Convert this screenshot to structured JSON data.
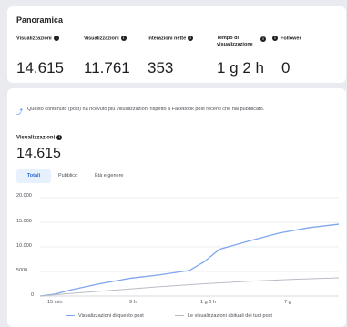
{
  "panorama": {
    "title": "Panoramica",
    "metrics": [
      {
        "label": "Visualizzazioni",
        "value": "14.615"
      },
      {
        "label": "Visualizzazioni",
        "value": "11.761"
      },
      {
        "label": "Interazioni nette",
        "value": "353"
      },
      {
        "label": "Tempo di visualizzazione",
        "value": "1 g 2 h"
      },
      {
        "label": "Follower",
        "value": "0"
      }
    ]
  },
  "notice": {
    "text": "Questo contenuto (post) ha ricevuto più visualizzazioni rispetto a Facebook post recenti che hai pubblicato."
  },
  "views": {
    "label": "Visualizzazioni",
    "value": "14.615"
  },
  "tabs": [
    "Totali",
    "Pubblico",
    "Età e genere"
  ],
  "chart_data": {
    "type": "line",
    "y_ticks": [
      "20.000",
      "15.000",
      "10.000",
      "5000",
      "0"
    ],
    "x_ticks": [
      "15 min",
      "9 h",
      "1 g 6 h",
      "7 g"
    ],
    "ylim": [
      0,
      20000
    ],
    "series": [
      {
        "name": "Visualizzazioni di questo post",
        "color": "#7fa6ee",
        "points": [
          [
            0,
            0
          ],
          [
            0.05,
            400
          ],
          [
            0.1,
            1200
          ],
          [
            0.2,
            2500
          ],
          [
            0.3,
            3600
          ],
          [
            0.4,
            4300
          ],
          [
            0.5,
            5200
          ],
          [
            0.55,
            7000
          ],
          [
            0.6,
            9500
          ],
          [
            0.7,
            11200
          ],
          [
            0.8,
            12800
          ],
          [
            0.9,
            13900
          ],
          [
            1.0,
            14615
          ]
        ]
      },
      {
        "name": "Le visualizzazioni abituali dei tuoi post",
        "color": "#b8bcc4",
        "points": [
          [
            0,
            0
          ],
          [
            0.1,
            500
          ],
          [
            0.25,
            1200
          ],
          [
            0.4,
            1900
          ],
          [
            0.55,
            2500
          ],
          [
            0.7,
            3000
          ],
          [
            0.85,
            3400
          ],
          [
            1.0,
            3700
          ]
        ]
      }
    ]
  },
  "colors": {
    "accent": "#2d6ad6",
    "line_primary": "#7fa6ee",
    "line_secondary": "#b8bcc4"
  }
}
